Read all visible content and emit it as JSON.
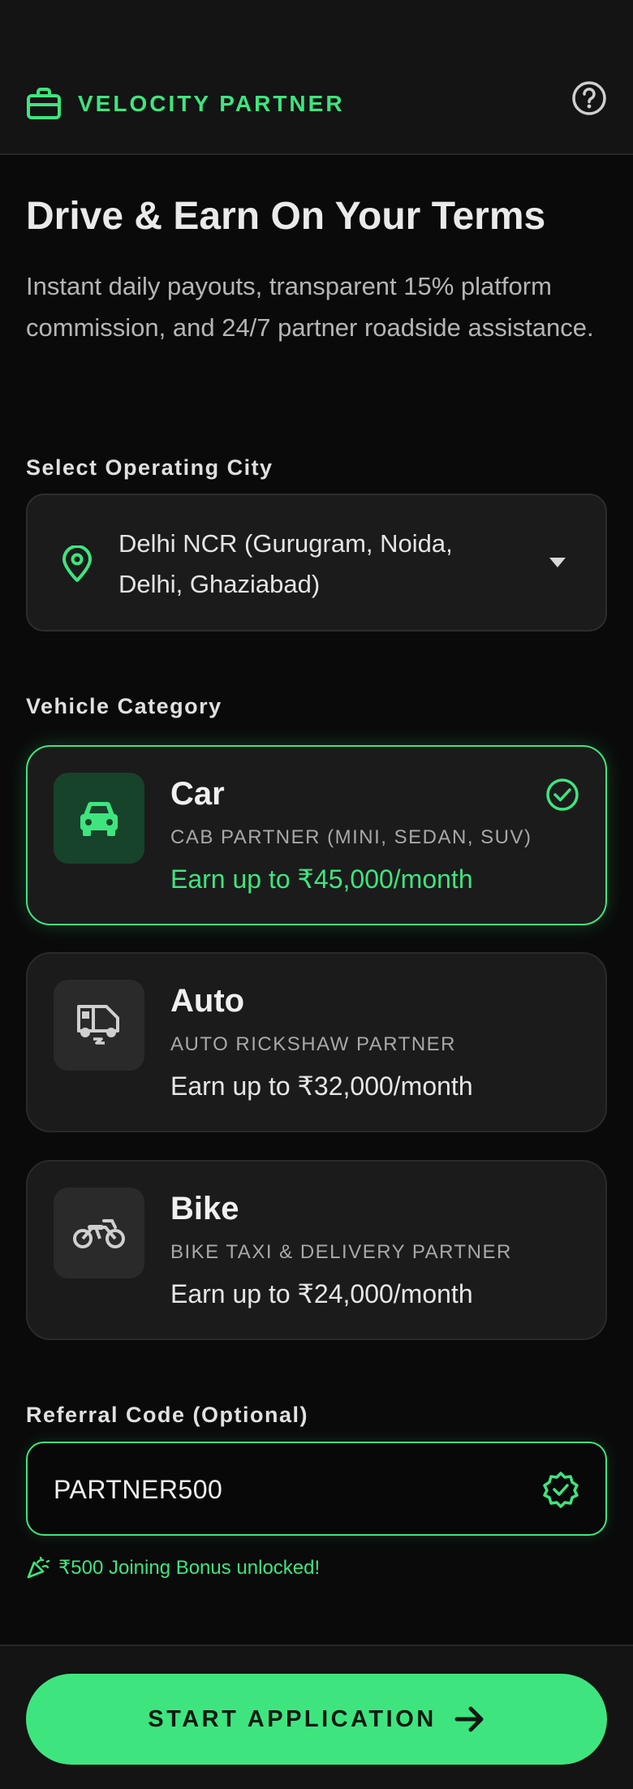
{
  "header": {
    "brand_name": "VELOCITY PARTNER",
    "brand_icon": "briefcase-icon",
    "help_icon": "help-circle-icon"
  },
  "hero": {
    "title": "Drive & Earn On Your Terms",
    "subtitle": "Instant daily payouts, transparent 15% platform commission, and 24/7 partner roadside assistance."
  },
  "city": {
    "label": "Select Operating City",
    "selected": "Delhi NCR (Gurugram, Noida, Delhi, Ghaziabad)",
    "icon": "map-pin-icon"
  },
  "vehicle": {
    "label": "Vehicle Category",
    "options": [
      {
        "name": "Car",
        "subtitle": "CAB PARTNER (MINI, SEDAN, SUV)",
        "earning": "Earn up to ₹45,000/month",
        "icon": "car-icon",
        "selected": true
      },
      {
        "name": "Auto",
        "subtitle": "AUTO RICKSHAW PARTNER",
        "earning": "Earn up to ₹32,000/month",
        "icon": "auto-rickshaw-icon",
        "selected": false
      },
      {
        "name": "Bike",
        "subtitle": "BIKE TAXI & DELIVERY PARTNER",
        "earning": "Earn up to ₹24,000/month",
        "icon": "motorbike-icon",
        "selected": false
      }
    ]
  },
  "referral": {
    "label": "Referral Code (Optional)",
    "value": "PARTNER500",
    "bonus_text": "₹500 Joining Bonus unlocked!"
  },
  "footer": {
    "cta_label": "START APPLICATION"
  },
  "colors": {
    "accent": "#3ee57f",
    "background": "#0a0a0a",
    "card": "#1b1b1b"
  }
}
